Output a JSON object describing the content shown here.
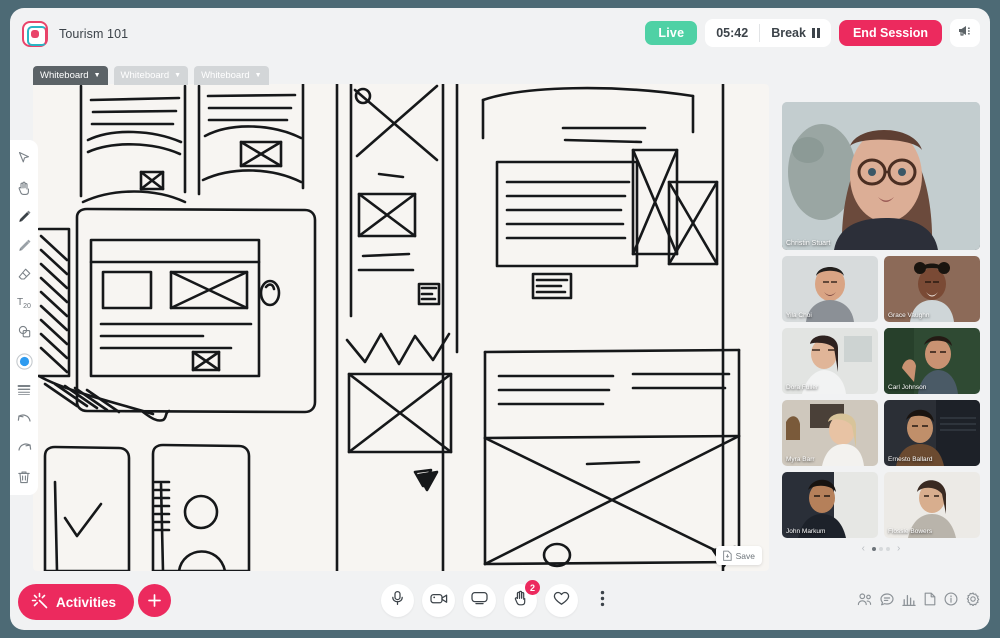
{
  "header": {
    "logo_icon": "app-logo-icon",
    "title": "Tourism 101",
    "live_label": "Live",
    "timer": "05:42",
    "break_label": "Break",
    "break_icon": "pause-icon",
    "end_session_label": "End Session",
    "announce_icon": "megaphone-icon"
  },
  "toolbar": {
    "tools": [
      {
        "name": "select-tool",
        "icon": "cursor-arrow-icon"
      },
      {
        "name": "pan-tool",
        "icon": "hand-icon"
      },
      {
        "name": "pencil-tool",
        "icon": "pencil-icon"
      },
      {
        "name": "brush-tool",
        "icon": "brush-icon"
      },
      {
        "name": "eraser-tool",
        "icon": "eraser-icon"
      },
      {
        "name": "text-tool",
        "icon": "text-icon",
        "label": "T",
        "size": "20"
      },
      {
        "name": "shapes-tool",
        "icon": "shapes-icon"
      },
      {
        "name": "color-tool",
        "icon": "color-circle-icon",
        "color": "#2e9bf0"
      },
      {
        "name": "stroke-width-tool",
        "icon": "lines-icon"
      },
      {
        "name": "undo-tool",
        "icon": "undo-arrow-icon"
      },
      {
        "name": "redo-tool",
        "icon": "redo-arrow-icon"
      },
      {
        "name": "delete-tool",
        "icon": "trash-icon"
      }
    ]
  },
  "board": {
    "tabs": [
      {
        "label": "Whiteboard",
        "active": true
      },
      {
        "label": "Whiteboard",
        "active": false
      },
      {
        "label": "Whiteboard",
        "active": false
      }
    ],
    "save_label": "Save",
    "save_icon": "save-document-icon",
    "content_description": "Hand-drawn wireframe sketches on paper"
  },
  "participants": {
    "featured": {
      "name": "Christin Stuart"
    },
    "rows": [
      [
        {
          "name": "Yila Choi"
        },
        {
          "name": "Grace Vaughn"
        }
      ],
      [
        {
          "name": "Dora Fuller"
        },
        {
          "name": "Carl Johnson"
        }
      ],
      [
        {
          "name": "Myra Barr"
        },
        {
          "name": "Ernesto Ballard"
        }
      ],
      [
        {
          "name": "John Markum"
        },
        {
          "name": "Flossie Bowers"
        }
      ]
    ],
    "pager": {
      "prev_icon": "chevron-left-icon",
      "next_icon": "chevron-right-icon",
      "pages": 3,
      "current_page": 1
    }
  },
  "bottom": {
    "activities_label": "Activities",
    "activities_icon": "sparkle-wand-icon",
    "add_icon": "plus-icon",
    "controls": [
      {
        "name": "microphone-button",
        "icon": "microphone-icon",
        "badge": null
      },
      {
        "name": "camera-button",
        "icon": "video-camera-icon",
        "badge": null
      },
      {
        "name": "screen-share-button",
        "icon": "monitor-icon",
        "badge": null
      },
      {
        "name": "raise-hand-button",
        "icon": "raised-hand-icon",
        "badge": "2"
      },
      {
        "name": "reactions-button",
        "icon": "heart-icon",
        "badge": null
      },
      {
        "name": "more-options-button",
        "icon": "more-vertical-icon",
        "badge": null
      }
    ],
    "right_icons": [
      {
        "name": "participants-button",
        "icon": "people-icon"
      },
      {
        "name": "chat-button",
        "icon": "chat-bubble-icon"
      },
      {
        "name": "polls-button",
        "icon": "bar-chart-icon"
      },
      {
        "name": "notes-button",
        "icon": "document-icon"
      },
      {
        "name": "info-button",
        "icon": "info-circle-icon"
      },
      {
        "name": "settings-button",
        "icon": "gear-icon"
      }
    ]
  },
  "colors": {
    "app_background": "#4d6a75",
    "window_background": "#f1f2f3",
    "accent_pink": "#ec2a5e",
    "live_green": "#4fd1a5",
    "board_paper": "#f7f5f2",
    "tool_blue": "#2e9bf0"
  }
}
